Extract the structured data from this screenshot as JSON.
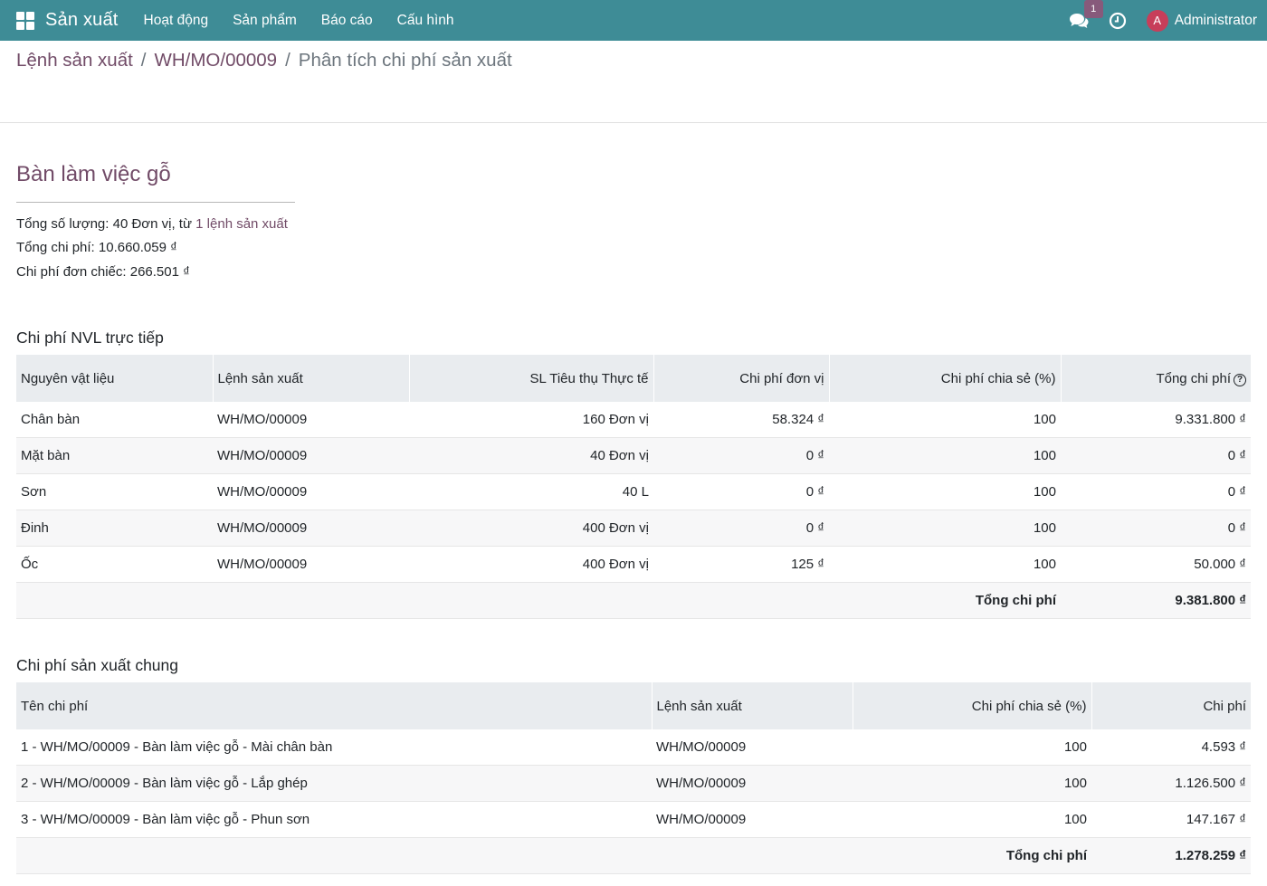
{
  "navbar": {
    "brand": "Sản xuất",
    "menu": [
      "Hoạt động",
      "Sản phẩm",
      "Báo cáo",
      "Cấu hình"
    ],
    "chat_badge": "1",
    "avatar_letter": "A",
    "user": "Administrator"
  },
  "breadcrumb": {
    "root": "Lệnh sản xuất",
    "record": "WH/MO/00009",
    "current": "Phân tích chi phí sản xuất",
    "separator": "/"
  },
  "product": {
    "title": "Bàn làm việc gỗ",
    "qty_prefix": "Tổng số lượng: 40 Đơn vị, từ ",
    "qty_link": "1 lệnh sản xuất",
    "total_cost": "Tổng chi phí: 10.660.059 ₫",
    "unit_cost": "Chi phí đơn chiếc: 266.501 ₫"
  },
  "materials": {
    "title": "Chi phí NVL trực tiếp",
    "headers": [
      "Nguyên vật liệu",
      "Lệnh sản xuất",
      "SL Tiêu thụ Thực tế",
      "Chi phí đơn vị",
      "Chi phí chia sẻ (%)",
      "Tổng chi phí"
    ],
    "rows": [
      [
        "Chân bàn",
        "WH/MO/00009",
        "160 Đơn vị",
        "58.324 ₫",
        "100",
        "9.331.800 ₫"
      ],
      [
        "Mặt bàn",
        "WH/MO/00009",
        "40 Đơn vị",
        "0 ₫",
        "100",
        "0 ₫"
      ],
      [
        "Sơn",
        "WH/MO/00009",
        "40 L",
        "0 ₫",
        "100",
        "0 ₫"
      ],
      [
        "Đinh",
        "WH/MO/00009",
        "400 Đơn vị",
        "0 ₫",
        "100",
        "0 ₫"
      ],
      [
        "Ốc",
        "WH/MO/00009",
        "400 Đơn vị",
        "125 ₫",
        "100",
        "50.000 ₫"
      ]
    ],
    "total_label": "Tổng chi phí",
    "total_value": "9.381.800 ₫"
  },
  "overhead": {
    "title": "Chi phí sản xuất chung",
    "headers": [
      "Tên chi phí",
      "Lệnh sản xuất",
      "Chi phí chia sẻ (%)",
      "Chi phí"
    ],
    "rows": [
      [
        "1 - WH/MO/00009 - Bàn làm việc gỗ - Mài chân bàn",
        "WH/MO/00009",
        "100",
        "4.593 ₫"
      ],
      [
        "2 - WH/MO/00009 - Bàn làm việc gỗ - Lắp ghép",
        "WH/MO/00009",
        "100",
        "1.126.500 ₫"
      ],
      [
        "3 - WH/MO/00009 - Bàn làm việc gỗ - Phun sơn",
        "WH/MO/00009",
        "100",
        "147.167 ₫"
      ]
    ],
    "total_label": "Tổng chi phí",
    "total_value": "1.278.259 ₫"
  }
}
